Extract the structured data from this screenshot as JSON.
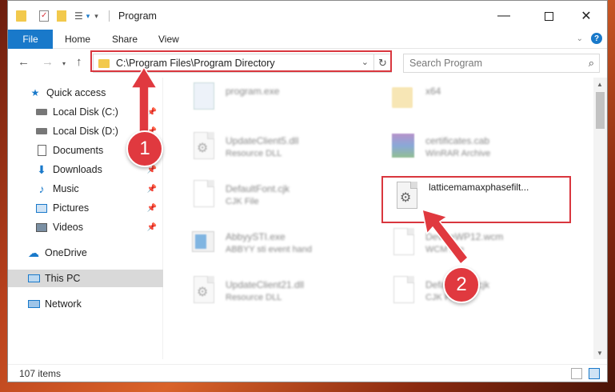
{
  "window": {
    "title": "Program"
  },
  "ribbon": {
    "tabs": [
      "File",
      "Home",
      "Share",
      "View"
    ],
    "help_glyph": "?"
  },
  "navigation": {
    "address": "C:\\Program Files\\Program Directory",
    "search_placeholder": "Search Program"
  },
  "sidebar": {
    "items": [
      {
        "label": "Quick access",
        "icon": "star-icon",
        "pinned": false
      },
      {
        "label": "Local Disk (C:)",
        "icon": "drive-icon",
        "pinned": true
      },
      {
        "label": "Local Disk (D:)",
        "icon": "drive-icon",
        "pinned": true
      },
      {
        "label": "Documents",
        "icon": "documents-icon",
        "pinned": true
      },
      {
        "label": "Downloads",
        "icon": "download-icon",
        "pinned": true
      },
      {
        "label": "Music",
        "icon": "music-icon",
        "pinned": true
      },
      {
        "label": "Pictures",
        "icon": "pictures-icon",
        "pinned": true
      },
      {
        "label": "Videos",
        "icon": "videos-icon",
        "pinned": true
      },
      {
        "label": "OneDrive",
        "icon": "cloud-icon",
        "pinned": false
      },
      {
        "label": "This PC",
        "icon": "computer-icon",
        "pinned": false,
        "selected": true
      },
      {
        "label": "Network",
        "icon": "network-icon",
        "pinned": false
      }
    ]
  },
  "files": [
    {
      "name": "program.exe",
      "type": ""
    },
    {
      "name": "x64",
      "type": ""
    },
    {
      "name": "UpdateClient5.dll",
      "type": "Resource DLL"
    },
    {
      "name": "certificates.cab",
      "type": "WinRAR Archive"
    },
    {
      "name": "DefaultFont.cjk",
      "type": "CJK File"
    },
    {
      "name": "latticemamaxphasefilt...",
      "type": ""
    },
    {
      "name": "AbbyySTI.exe",
      "type": "ABBYY sti event hand"
    },
    {
      "name": "DeviceWP12.wcm",
      "type": "WCM File"
    },
    {
      "name": "UpdateClient21.dll",
      "type": "Resource DLL"
    },
    {
      "name": "DefaultFont.cjk",
      "type": "CJK File"
    }
  ],
  "status": {
    "item_count": "107 items"
  },
  "callouts": {
    "step1": "1",
    "step2": "2"
  },
  "colors": {
    "accent": "#1979ca",
    "highlight": "#d9363e",
    "callout": "#e0393f"
  }
}
